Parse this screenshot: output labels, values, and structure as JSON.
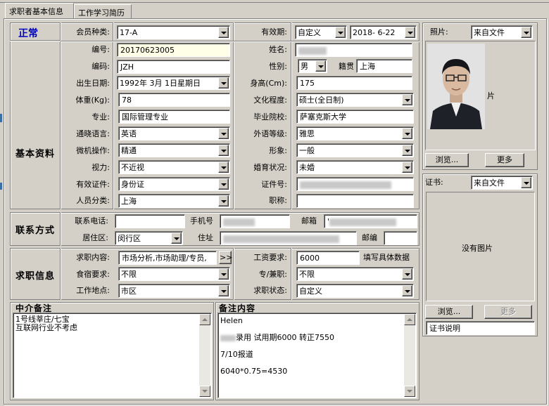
{
  "tabs": [
    "求职者基本信息",
    "工作学习简历"
  ],
  "status": "正常",
  "sections": {
    "basic": "基本资料",
    "contact": "联系方式",
    "job": "求职信息"
  },
  "labels": {
    "member_type": "会员种类:",
    "validity": "有效期:",
    "number": "编号:",
    "name": "姓名:",
    "code": "编码:",
    "gender": "性别:",
    "hometown": "籍贯",
    "birthdate": "出生日期:",
    "height": "身高(Cm):",
    "weight": "体重(Kg):",
    "education": "文化程度:",
    "major": "专业:",
    "school": "毕业院校:",
    "language": "通晓语言:",
    "lang_level": "外语等级:",
    "computer": "微机操作:",
    "appearance": "形象:",
    "eyesight": "视力:",
    "marital": "婚育状况:",
    "id_type": "有效证件:",
    "id_number": "证件号:",
    "category": "人员分类:",
    "title": "职称:",
    "phone": "联系电话:",
    "mobile": "手机号",
    "email": "邮箱",
    "district": "居住区:",
    "address": "住址",
    "postcode": "邮编",
    "job_content": "求职内容:",
    "salary": "工资要求:",
    "salary_hint": "填写具体数据",
    "board": "食宿要求:",
    "fulltime": "专/兼职:",
    "workplace": "工作地点:",
    "job_status": "求职状态:",
    "agency_note": "中介备注",
    "note_content": "备注内容",
    "photo": "照片:",
    "certificate": "证书:",
    "no_image": "没有图片",
    "cert_desc": "证书说明",
    "browse": "浏览...",
    "more": "更多",
    "photo_alt": "片"
  },
  "values": {
    "member_type": "17-A",
    "validity": "自定义",
    "expire_date": "2018- 6-22",
    "number": "20170623005",
    "code": "JZH",
    "gender": "男",
    "hometown": "上海",
    "birthdate": "1992年 3月 1日星期日",
    "height": "175",
    "weight": "78",
    "education": "硕士(全日制)",
    "major": "国际管理专业",
    "school": "萨塞克斯大学",
    "language": "英语",
    "lang_level": "雅思",
    "computer": "精通",
    "appearance": "一般",
    "eyesight": "不近视",
    "marital": "未婚",
    "id_type": "身份证",
    "category": "上海",
    "district": "闵行区",
    "email_prefix": "'",
    "job_content": "市场分析,市场助理/专员,",
    "salary": "6000",
    "board": "不限",
    "fulltime": "不限",
    "workplace": "市区",
    "job_status": "自定义",
    "photo_source": "来自文件",
    "cert_source": "来自文件"
  },
  "agency_note_lines": [
    "1号线莘庄/七宝",
    "互联网行业不考虑"
  ],
  "note_lines": [
    "Helen",
    "录用  试用期6000  转正7550",
    "7/10报道",
    "6040*0.75=4530"
  ],
  "more_button": ">>"
}
